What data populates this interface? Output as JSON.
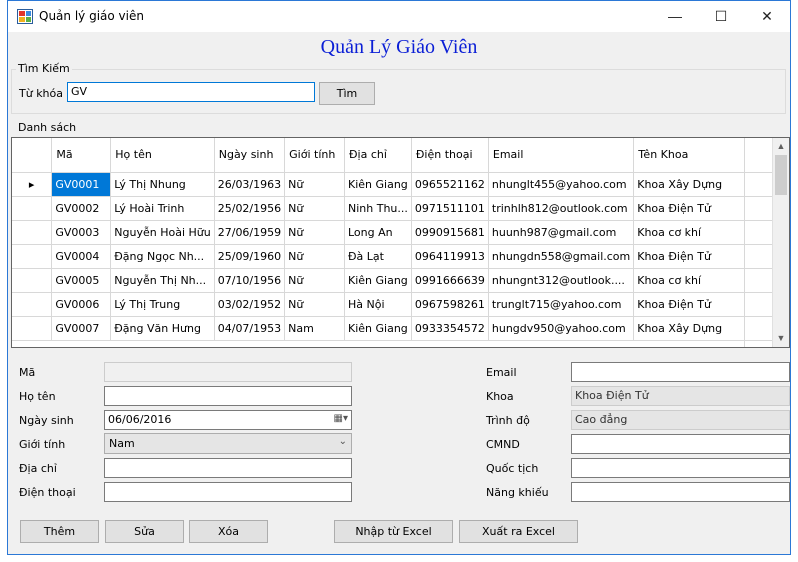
{
  "window": {
    "title": "Quản lý giáo viên",
    "minimize": "—",
    "maximize": "☐",
    "close": "✕"
  },
  "heading": "Quản Lý Giáo Viên",
  "search": {
    "group_label": "Tìm Kiếm",
    "keyword_label": "Từ khóa",
    "keyword_value": "GV",
    "search_button": "Tìm"
  },
  "list": {
    "group_label": "Danh sách",
    "columns": [
      "Mã",
      "Họ tên",
      "Ngày sinh",
      "Giới tính",
      "Địa chỉ",
      "Điện thoại",
      "Email",
      "Tên Khoa"
    ],
    "rows": [
      [
        "GV0001",
        "Lý Thị Nhung",
        "26/03/1963",
        "Nữ",
        "Kiên Giang",
        "0965521162",
        "nhunglt455@yahoo.com",
        "Khoa Xây Dựng"
      ],
      [
        "GV0002",
        "Lý Hoài Trinh",
        "25/02/1956",
        "Nữ",
        "Ninh Thu...",
        "0971511101",
        "trinhlh812@outlook.com",
        "Khoa Điện Tử"
      ],
      [
        "GV0003",
        "Nguyễn Hoài Hữu",
        "27/06/1959",
        "Nữ",
        "Long An",
        "0990915681",
        "huunh987@gmail.com",
        "Khoa cơ khí"
      ],
      [
        "GV0004",
        "Đặng Ngọc Nh...",
        "25/09/1960",
        "Nữ",
        "Đà Lạt",
        "0964119913",
        "nhungdn558@gmail.com",
        "Khoa Điện Tử"
      ],
      [
        "GV0005",
        "Nguyễn Thị Nh...",
        "07/10/1956",
        "Nữ",
        "Kiên Giang",
        "0991666639",
        "nhungnt312@outlook....",
        "Khoa cơ khí"
      ],
      [
        "GV0006",
        "Lý Thị Trung",
        "03/02/1952",
        "Nữ",
        "Hà Nội",
        "0967598261",
        "trunglt715@yahoo.com",
        "Khoa Điện Tử"
      ],
      [
        "GV0007",
        "Đặng Văn Hưng",
        "04/07/1953",
        "Nam",
        "Kiên Giang",
        "0933354572",
        "hungdv950@yahoo.com",
        "Khoa Xây Dựng"
      ]
    ]
  },
  "form": {
    "ma_label": "Mã",
    "ma_value": "",
    "hoten_label": "Họ tên",
    "hoten_value": "",
    "ngaysinh_label": "Ngày sinh",
    "ngaysinh_value": "06/06/2016",
    "gioitinh_label": "Giới tính",
    "gioitinh_value": "Nam",
    "diachi_label": "Địa chỉ",
    "diachi_value": "",
    "dienthoai_label": "Điện thoại",
    "dienthoai_value": "",
    "email_label": "Email",
    "email_value": "",
    "khoa_label": "Khoa",
    "khoa_value": "Khoa Điện Tử",
    "trinhdo_label": "Trình độ",
    "trinhdo_value": "Cao đẳng",
    "cmnd_label": "CMND",
    "cmnd_value": "",
    "quoctich_label": "Quốc tịch",
    "quoctich_value": "",
    "nangkhieu_label": "Năng khiếu",
    "nangkhieu_value": ""
  },
  "buttons": {
    "them": "Thêm",
    "sua": "Sửa",
    "xoa": "Xóa",
    "import_excel": "Nhập từ Excel",
    "export_excel": "Xuất ra Excel"
  },
  "icons": {
    "calendar": "calendar-icon",
    "dropdown": "chevron-down-icon",
    "row_pointer": "row-pointer-icon"
  },
  "colors": {
    "heading": "#0b1fd6",
    "selection": "#0078d7",
    "window_border": "#2b78d6"
  }
}
